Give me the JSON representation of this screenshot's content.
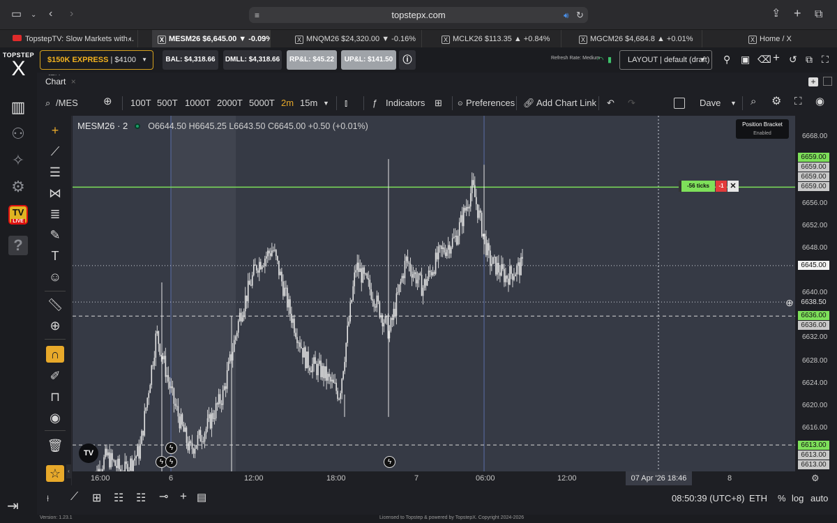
{
  "browser": {
    "url": "topstepx.com",
    "tabs": [
      {
        "label": "TopstepTV: Slow Markets with...",
        "kind": "youtube"
      },
      {
        "label": "MESM26 $6,645.00 ▼ -0.09%",
        "kind": "x",
        "active": true
      },
      {
        "label": "MNQM26 $24,320.00 ▼ -0.16%",
        "kind": "x"
      },
      {
        "label": "MCLK26 $113.35 ▲ +0.84%",
        "kind": "x"
      },
      {
        "label": "MGCM26 $4,684.8 ▲ +0.01%",
        "kind": "x"
      },
      {
        "label": "Home / X",
        "kind": "x"
      }
    ]
  },
  "app": {
    "logo_top": "TOPSTEP",
    "logo_mark": "X",
    "account_type": "$150K EXPRESS",
    "account_rest": "| $4100 (EX...",
    "bal": "BAL: $4,318.66",
    "dmll": "DMLL: $4,318.66",
    "rpl": "RP&L: $45.22",
    "upl": "UP&L: $141.50",
    "refresh_rate": "Refresh Rate: Medium",
    "layout": "LAYOUT | default (draft)",
    "tv_live": "LIVE",
    "tv_label": "TV"
  },
  "chart_tab": {
    "label": "Chart",
    "close": "×"
  },
  "toolbar": {
    "symbol": "/MES",
    "intervals": [
      "100T",
      "500T",
      "1000T",
      "2000T",
      "5000T",
      "2m",
      "15m"
    ],
    "active_interval": "2m",
    "indicators": "Indicators",
    "preferences": "Preferences",
    "add_chart_link": "Add Chart Link",
    "account_name": "Dave"
  },
  "legend": {
    "symbol": "MESM26 · 2",
    "open": "O6644.50",
    "high": "H6645.25",
    "low": "L6643.50",
    "close": "C6645.00",
    "change": "+0.50 (+0.01%)"
  },
  "tooltip": {
    "title": "Position Bracket",
    "status": "Enabled"
  },
  "bracket": {
    "ticks": "-56 ticks",
    "qty": "-1",
    "close": "✕"
  },
  "price_axis": {
    "labels": [
      "6668.00",
      "6656.00",
      "6652.00",
      "6648.00",
      "6640.00",
      "6632.00",
      "6628.00",
      "6624.00",
      "6620.00",
      "6616.00"
    ],
    "tags": [
      {
        "text": "6659.00",
        "kind": "green"
      },
      {
        "text": "6659.00",
        "kind": "grey"
      },
      {
        "text": "6659.00",
        "kind": "grey"
      },
      {
        "text": "6659.00",
        "kind": "grey"
      },
      {
        "text": "6645.00",
        "kind": "white"
      },
      {
        "text": "6638.50",
        "kind": "dark"
      },
      {
        "text": "6636.00",
        "kind": "green"
      },
      {
        "text": "6636.00",
        "kind": "grey"
      },
      {
        "text": "6613.00",
        "kind": "green"
      },
      {
        "text": "6613.00",
        "kind": "grey"
      },
      {
        "text": "6613.00",
        "kind": "grey"
      }
    ]
  },
  "time_axis": {
    "labels": [
      "16:00",
      "6",
      "12:00",
      "18:00",
      "7",
      "06:00",
      "12:00",
      "8"
    ],
    "crosshair_label": "07 Apr '26   18:46"
  },
  "bottom": {
    "clock": "08:50:39 (UTC+8)",
    "session": "ETH",
    "pct": "%",
    "log": "log",
    "auto": "auto"
  },
  "footer": {
    "version": "Version: 1.23.1",
    "license": "Licensed to Topstep & powered by TopstepX. Copyright 2024-2026"
  },
  "colors": {
    "accent": "#e8a92a",
    "green": "#7ee05a",
    "chart_bg": "#363a45",
    "candles": "#e6e6e6"
  },
  "chart_data": {
    "type": "candlestick",
    "symbol": "MESM26",
    "interval": "2m",
    "ylim": [
      6610,
      6670
    ],
    "x_labels": [
      "16:00",
      "6",
      "12:00",
      "18:00",
      "7",
      "06:00",
      "12:00",
      "8"
    ],
    "approx_close_path": [
      6606,
      6611,
      6608,
      6612,
      6633,
      6621,
      6612,
      6616,
      6622,
      6636,
      6645,
      6648,
      6637,
      6628,
      6626,
      6622,
      6645,
      6640,
      6633,
      6646,
      6641,
      6647,
      6650,
      6659,
      6646,
      6643,
      6645
    ],
    "lines": [
      {
        "price": 6659.0,
        "style": "solid",
        "color": "green",
        "label": "-56 ticks"
      },
      {
        "price": 6645.0,
        "style": "dotted",
        "label": "last price"
      },
      {
        "price": 6638.5,
        "style": "dotted",
        "label": "crosshair"
      },
      {
        "price": 6636.0,
        "style": "dashed"
      },
      {
        "price": 6613.0,
        "style": "dashed"
      }
    ]
  }
}
